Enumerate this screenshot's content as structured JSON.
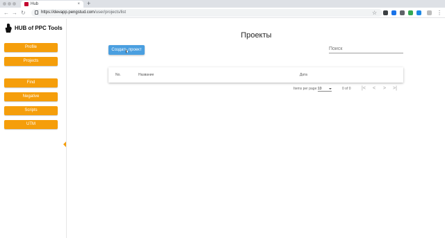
{
  "browser": {
    "tab_title": "Hub",
    "tab_close": "×",
    "new_tab": "+",
    "back": "←",
    "forward": "→",
    "reload": "↻",
    "url_host": "https://devapp.pengstud.com",
    "url_path": "/user/projects/list",
    "star": "☆",
    "menu": "⋮"
  },
  "sidebar": {
    "logo_text": "HUB of PPC Tools",
    "items": [
      {
        "label": "Profile"
      },
      {
        "label": "Projects"
      },
      {
        "label": "Find"
      },
      {
        "label": "Negative"
      },
      {
        "label": "Scripts"
      },
      {
        "label": "UTM"
      }
    ],
    "accent": "#f59e0b"
  },
  "main": {
    "title": "Проекты",
    "create_button": "Создать проект",
    "search_placeholder": "Поиск",
    "table": {
      "headers": [
        "No.",
        "Название",
        "Дата"
      ]
    },
    "paginator": {
      "items_per_page_label": "Items per page:",
      "page_size": "10",
      "range": "0 of 0",
      "first": "|<",
      "prev": "<",
      "next": ">",
      "last": ">|"
    },
    "button_color": "#4a9fe0"
  }
}
